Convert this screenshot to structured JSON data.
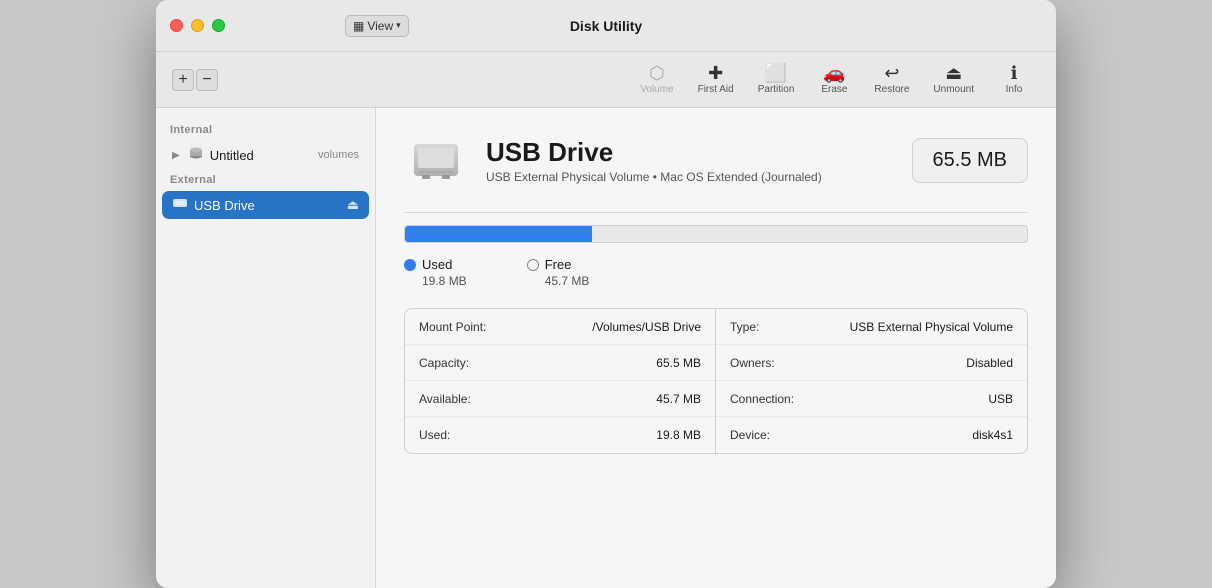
{
  "window": {
    "title": "Disk Utility"
  },
  "titlebar": {
    "view_label": "View",
    "view_icon": "▦"
  },
  "toolbar": {
    "add_label": "+",
    "remove_label": "−",
    "volume_label": "Volume",
    "firstaid_label": "First Aid",
    "partition_label": "Partition",
    "erase_label": "Erase",
    "restore_label": "Restore",
    "unmount_label": "Unmount",
    "info_label": "Info"
  },
  "sidebar": {
    "internal_label": "Internal",
    "internal_item": {
      "name": "Untitled",
      "volumes_label": "volumes"
    },
    "external_label": "External",
    "external_item": {
      "name": "USB Drive"
    }
  },
  "content": {
    "drive_name": "USB Drive",
    "drive_subtitle": "USB External Physical Volume • Mac OS Extended (Journaled)",
    "drive_size": "65.5 MB",
    "used_label": "Used",
    "free_label": "Free",
    "used_value": "19.8 MB",
    "free_value": "45.7 MB",
    "used_pct": 30,
    "info": {
      "mount_point_key": "Mount Point:",
      "mount_point_val": "/Volumes/USB Drive",
      "capacity_key": "Capacity:",
      "capacity_val": "65.5 MB",
      "available_key": "Available:",
      "available_val": "45.7 MB",
      "used_key": "Used:",
      "used_val": "19.8 MB",
      "type_key": "Type:",
      "type_val": "USB External Physical Volume",
      "owners_key": "Owners:",
      "owners_val": "Disabled",
      "connection_key": "Connection:",
      "connection_val": "USB",
      "device_key": "Device:",
      "device_val": "disk4s1"
    }
  }
}
